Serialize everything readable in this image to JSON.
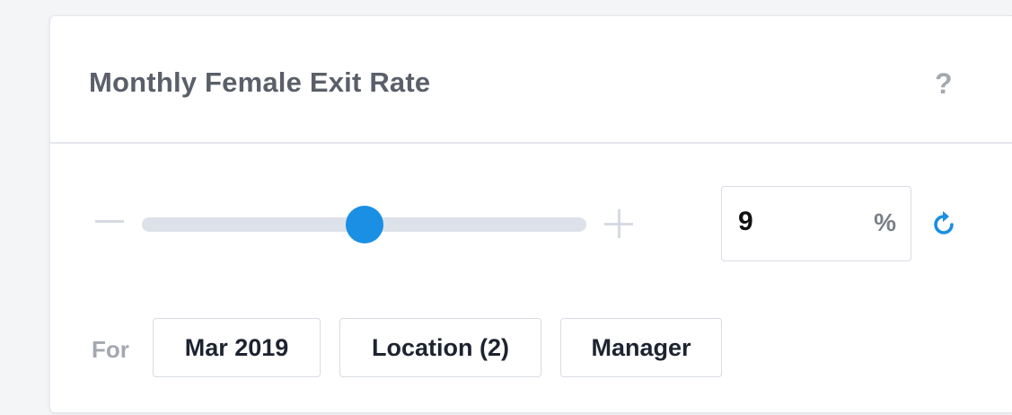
{
  "card": {
    "title": "Monthly Female Exit Rate",
    "help_label": "?"
  },
  "slider": {
    "value_fraction": 0.5,
    "accent_color": "#1a8fe3"
  },
  "value_field": {
    "value": "9",
    "unit": "%"
  },
  "icons": {
    "decrease": "minus-icon",
    "increase": "plus-icon",
    "reset": "refresh-icon"
  },
  "filters": {
    "label": "For",
    "chips": [
      {
        "label": "Mar 2019"
      },
      {
        "label": "Location (2)"
      },
      {
        "label": "Manager"
      }
    ]
  }
}
